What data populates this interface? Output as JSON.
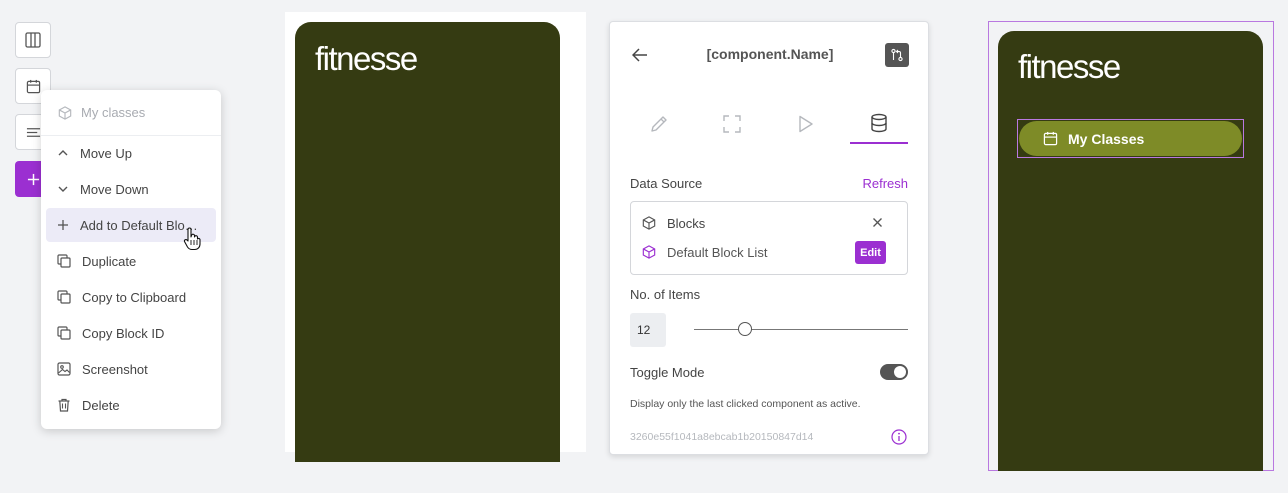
{
  "toolbar": {
    "buttons": [
      {
        "icon": "columns-icon"
      },
      {
        "icon": "calendar-icon"
      },
      {
        "icon": "text-align-icon"
      },
      {
        "icon": "plus-icon"
      }
    ]
  },
  "context_menu": {
    "header": {
      "label": "My classes",
      "icon": "cube-icon"
    },
    "items": [
      {
        "label": "Move Up",
        "icon": "chevron-up-icon"
      },
      {
        "label": "Move Down",
        "icon": "chevron-down-icon"
      },
      {
        "label": "Add to Default Bloc...",
        "icon": "plus-icon",
        "hovered": true
      },
      {
        "label": "Duplicate",
        "icon": "copy-icon"
      },
      {
        "label": "Copy to Clipboard",
        "icon": "copy-icon"
      },
      {
        "label": "Copy Block ID",
        "icon": "copy-icon"
      },
      {
        "label": "Screenshot",
        "icon": "image-icon"
      },
      {
        "label": "Delete",
        "icon": "trash-icon"
      }
    ]
  },
  "preview_left": {
    "logo": "fitnesse",
    "background": "#353b12"
  },
  "panel": {
    "title": "[component.Name]",
    "tabs": [
      {
        "icon": "pencil-icon"
      },
      {
        "icon": "expand-icon"
      },
      {
        "icon": "play-icon"
      },
      {
        "icon": "database-icon",
        "active": true
      }
    ],
    "data_source_label": "Data Source",
    "refresh_label": "Refresh",
    "source_name": "Blocks",
    "source_list": "Default Block List",
    "edit_label": "Edit",
    "items_label": "No. of Items",
    "items_value": "12",
    "toggle_label": "Toggle Mode",
    "toggle_on": true,
    "toggle_hint": "Display only the last clicked component as active.",
    "component_id": "3260e55f1041a8ebcab1b20150847d14"
  },
  "preview_right": {
    "logo": "fitnesse",
    "button_label": "My Classes",
    "button_color": "#7e8b27"
  },
  "colors": {
    "accent": "#9b2fd1",
    "dark_olive": "#353b12"
  }
}
